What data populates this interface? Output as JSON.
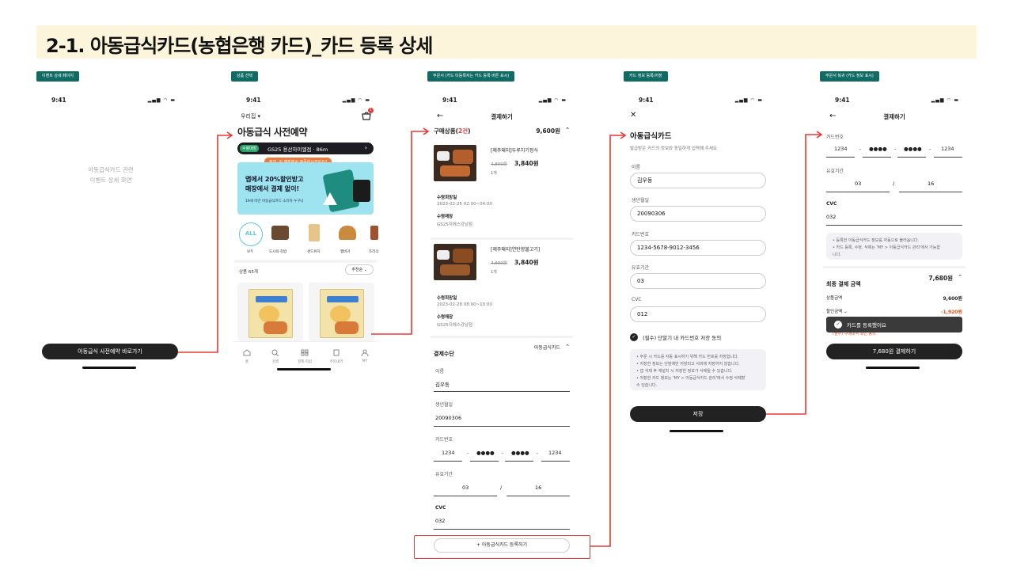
{
  "title": "2-1. 아동급식카드(농협은행 카드)_카드 등록 상세",
  "status_time": "9:41",
  "status_icons": "▂▄▆ ◠ ▬",
  "screens": {
    "s1": {
      "tag": "이벤트 상세 페이지",
      "placeholder_line1": "아동급식카드 관련",
      "placeholder_line2": "이벤트 상세 화면",
      "cta": "아동급식 사전예약 바로가기"
    },
    "s2": {
      "tag": "상품 선택",
      "location": "우리집 ▾",
      "heading": "아동급식 사전예약",
      "store_badge": "수령매장",
      "store_name": "GS25 용산하이엘점 · 86m",
      "tooltip": "잠깐, 이 매장에서 주문하시겠어요?",
      "banner_line1": "앱에서 20%할인받고",
      "banner_line2": "매장에서 결제 없이!",
      "banner_note": "19세 미만 아동급식카드 소유자 누구나",
      "categories": [
        "ALL",
        "",
        "",
        "",
        ""
      ],
      "category_labels": [
        "보두",
        "도시락·김밥",
        "샌드위치",
        "햄버거",
        "조리식"
      ],
      "product_count": "상품 65개",
      "sort": "추천순 ⌄",
      "bottom_nav": [
        "홈",
        "검색",
        "결제·적립",
        "주문내역",
        "MY"
      ],
      "cart_count": "1"
    },
    "s3": {
      "tag": "주문서 (카드 미등록자는 카드 등록 버튼 표시)",
      "header": "결제하기",
      "section_title": "구매상품(",
      "section_count": "2건",
      "section_close": ")",
      "section_total": "9,600원",
      "items": [
        {
          "name": "[제주돼지]두루치기정식",
          "orig": "4,800원",
          "price": "3,840원",
          "qty": "1개",
          "date_label": "수령희망일",
          "date": "2023-02-25 02:00~04:00",
          "store_label": "수령매장",
          "store": "GS25지에스강남점"
        },
        {
          "name": "[제주돼지]연탄향불고기]",
          "orig": "4,800원",
          "price": "3,840원",
          "qty": "1개",
          "date_label": "수령희망일",
          "date": "2023-02-28 08:00~10:00",
          "store_label": "수령매장",
          "store": "GS25지에스강남점"
        }
      ],
      "pay_label": "결제수단",
      "pay_value": "아동급식카드",
      "name_label": "이름",
      "name_value": "김우동",
      "birth_label": "생년월일",
      "birth_value": "20090306",
      "card_label": "카드번호",
      "card_parts": [
        "1234",
        "●●●●",
        "●●●●",
        "1234"
      ],
      "exp_label": "유효기간",
      "exp_mm": "03",
      "exp_yy": "16",
      "cvc_label": "CVC",
      "cvc_value": "032",
      "register_btn": "+ 아동급식카드 등록하기"
    },
    "s4": {
      "tag": "카드 정보 등록/저장",
      "close": "✕",
      "heading": "아동급식카드",
      "sub": "발급받은 카드의 정보와 동일하게 입력해 주세요",
      "name_label": "이름",
      "name_value": "김우동",
      "birth_label": "생년월일",
      "birth_value": "20090306",
      "card_label": "카드번호",
      "card_value": "1234-5678-9012-3456",
      "exp_label": "유효기간",
      "exp_value": "03",
      "cvc_label": "CVC",
      "cvc_value": "012",
      "agree": "(필수) 단말기 내 카드번호 저장 동의",
      "notice": [
        "• 주문 시 카드를 자동 표시하기 위해 카드 번호를 저장합니다.",
        "• 저장한 정보는 단말에만 저장되고 서버에 저장하지 않습니다.",
        "• 앱 삭제 후 재설치 시 저장한 정보가 삭제될 수 있습니다.",
        "• 저장한 카드 정보는 'MY > 아동급식카드 관리'에서 수정·삭제할",
        "  수 있습니다."
      ],
      "save": "저장"
    },
    "s5": {
      "tag": "주문서 복귀 (카드 정보 표시)",
      "header": "결제하기",
      "card_label": "카드번호",
      "card_parts": [
        "1234",
        "●●●●",
        "●●●●",
        "1234"
      ],
      "exp_label": "유효기간",
      "exp_mm": "03",
      "exp_yy": "16",
      "cvc_label": "CVC",
      "cvc_value": "032",
      "notice": [
        "• 등록한 아동급식카드 정보를 자동으로 불러옵니다.",
        "• 카드 등록, 수정, 삭제는 'MY > 아동급식카드 관리'에서 가능합",
        "  니다."
      ],
      "final_label": "최종 결제 금액",
      "final_value": "7,680원",
      "goods_label": "상품금액",
      "goods_value": "9,600원",
      "disc_label": "할인금액 ⌄",
      "disc_value": "-1,920원",
      "toast": "카드를 등록했어요",
      "agree_partial": "(필수) 구매내역 확인 동의",
      "pay_btn": "7,680원 결제하기"
    }
  }
}
